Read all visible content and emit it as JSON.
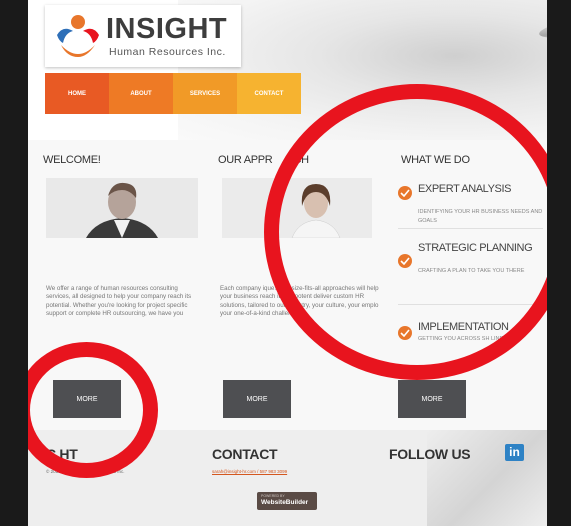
{
  "brand": {
    "name": "INSIGHT",
    "tagline": "Human Resources Inc.",
    "colors": {
      "nav1": "#e85a24",
      "nav2": "#ee7a25",
      "nav3": "#f19a27",
      "nav4": "#f6b330",
      "accent": "#e8762b",
      "annotation": "#e8141e"
    }
  },
  "nav": {
    "items": [
      {
        "label": "HOME"
      },
      {
        "label": "ABOUT"
      },
      {
        "label": "SERVICES"
      },
      {
        "label": "CONTACT"
      }
    ]
  },
  "welcome": {
    "title": "WELCOME!",
    "image_icon": "man-in-suit-photo",
    "text": "We offer a range of human resources consulting services, all designed to help your company reach its potential. Whether you're looking for project specific support or complete HR outsourcing, we have you",
    "button": "MORE"
  },
  "approach": {
    "title": "OUR APPR",
    "title_end": "ACH",
    "image_icon": "woman-smiling-photo",
    "text": "Each company          ique. One-size-fits-all approaches will        help your business reach its full potent       deliver custom HR solutions, tailored to       our industry, your culture, your emplo       your one-of-a-kind challenges.",
    "button": "MORE"
  },
  "what_we_do": {
    "title": "WHAT WE DO",
    "icon": "check-circle-icon",
    "items": [
      {
        "title": "EXPERT ANALYSIS",
        "desc": "IDENTIFYING YOUR HR BUSINESS NEEDS AND GOALS"
      },
      {
        "title": "STRATEGIC PLANNING",
        "desc": "CRAFTING A PLAN TO TAKE YOU THERE"
      },
      {
        "title": "IMPLEMENTATION",
        "desc": "GETTING YOU ACROSS           SH LINE"
      }
    ],
    "button": "MORE"
  },
  "footer": {
    "copyright_title": "C          HT",
    "copyright_text": "© 2016 | Insight Human Resources Inc.",
    "contact_title": "CONTACT",
    "contact_text": "sarah@insight-hr.com / 587 983 3099",
    "follow_title": "FOLLOW US",
    "linkedin_icon": "linkedin-icon",
    "linkedin_label": "in",
    "badge_small": "POWERED BY",
    "badge_label": "WebsiteBuilder"
  }
}
